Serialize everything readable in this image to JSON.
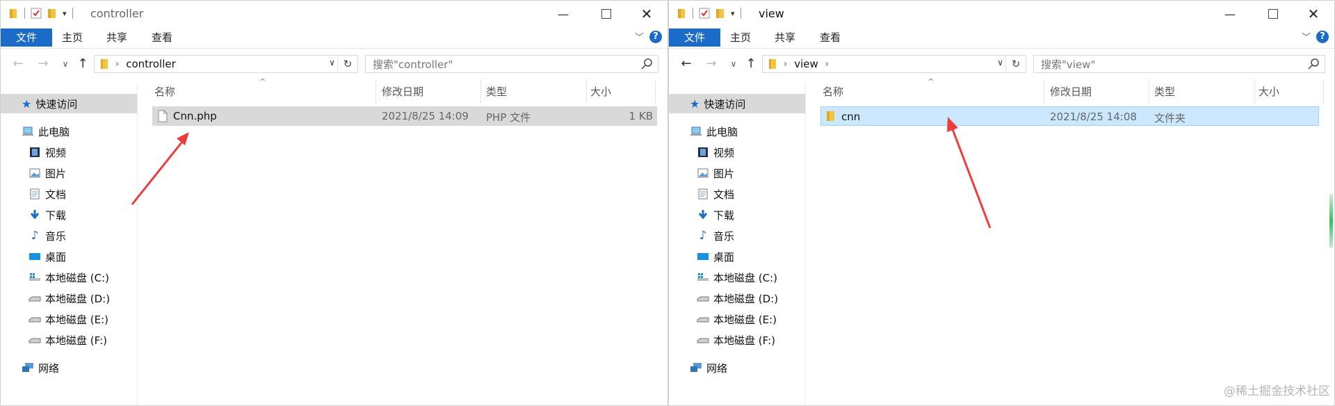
{
  "colors": {
    "accent": "#1b6cc9",
    "selected_grey": "#d9d9d9",
    "selected_blue": "#cce8ff",
    "arrow": "#ee3b3b"
  },
  "left": {
    "title": "controller",
    "ribbon": {
      "file": "文件",
      "home": "主页",
      "share": "共享",
      "view": "查看",
      "help": "?"
    },
    "address": {
      "path": [
        "controller"
      ],
      "dropdown_icon": "chevron-down-icon"
    },
    "search": {
      "placeholder": "搜索\"controller\""
    },
    "nav": {
      "quick_access": "快速访问",
      "this_pc": "此电脑",
      "videos": "视频",
      "pictures": "图片",
      "documents": "文档",
      "downloads": "下载",
      "music": "音乐",
      "desktop": "桌面",
      "drive_c": "本地磁盘 (C:)",
      "drive_d": "本地磁盘 (D:)",
      "drive_e": "本地磁盘 (E:)",
      "drive_f": "本地磁盘 (F:)",
      "network": "网络"
    },
    "columns": {
      "name": "名称",
      "modified": "修改日期",
      "type": "类型",
      "size": "大小"
    },
    "files": [
      {
        "name": "Cnn.php",
        "modified": "2021/8/25 14:09",
        "type": "PHP 文件",
        "size": "1 KB",
        "icon": "file-icon"
      }
    ]
  },
  "right": {
    "title": "view",
    "ribbon": {
      "file": "文件",
      "home": "主页",
      "share": "共享",
      "view": "查看",
      "help": "?"
    },
    "address": {
      "path": [
        "view"
      ],
      "dropdown_icon": "chevron-down-icon"
    },
    "search": {
      "placeholder": "搜索\"view\""
    },
    "nav": {
      "quick_access": "快速访问",
      "this_pc": "此电脑",
      "videos": "视频",
      "pictures": "图片",
      "documents": "文档",
      "downloads": "下载",
      "music": "音乐",
      "desktop": "桌面",
      "drive_c": "本地磁盘 (C:)",
      "drive_d": "本地磁盘 (D:)",
      "drive_e": "本地磁盘 (E:)",
      "drive_f": "本地磁盘 (F:)",
      "network": "网络"
    },
    "columns": {
      "name": "名称",
      "modified": "修改日期",
      "type": "类型",
      "size": "大小"
    },
    "files": [
      {
        "name": "cnn",
        "modified": "2021/8/25 14:08",
        "type": "文件夹",
        "size": "",
        "icon": "folder-icon"
      }
    ]
  },
  "watermark": "@稀土掘金技术社区"
}
